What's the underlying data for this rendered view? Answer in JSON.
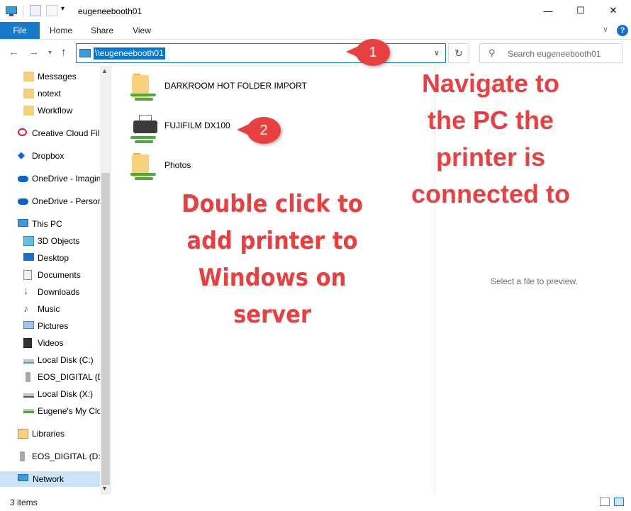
{
  "window": {
    "title": "eugeneebooth01"
  },
  "ribbon": {
    "tabs": [
      "File",
      "Home",
      "Share",
      "View"
    ]
  },
  "nav": {
    "address": "\\\\eugeneebooth01",
    "search_placeholder": "Search eugeneebooth01"
  },
  "sidebar": {
    "items": [
      {
        "label": "Messages",
        "icon": "folder-icon"
      },
      {
        "label": "notext",
        "icon": "folder-icon"
      },
      {
        "label": "Workflow",
        "icon": "folder-icon"
      },
      {
        "label": "Creative Cloud Fil",
        "icon": "creative-cloud-icon"
      },
      {
        "label": "Dropbox",
        "icon": "dropbox-icon"
      },
      {
        "label": "OneDrive - Imagin",
        "icon": "onedrive-icon"
      },
      {
        "label": "OneDrive - Person",
        "icon": "onedrive-icon"
      },
      {
        "label": "This PC",
        "icon": "pc-icon"
      },
      {
        "label": "3D Objects",
        "icon": "3d-objects-icon"
      },
      {
        "label": "Desktop",
        "icon": "desktop-icon"
      },
      {
        "label": "Documents",
        "icon": "documents-icon"
      },
      {
        "label": "Downloads",
        "icon": "downloads-icon"
      },
      {
        "label": "Music",
        "icon": "music-icon"
      },
      {
        "label": "Pictures",
        "icon": "pictures-icon"
      },
      {
        "label": "Videos",
        "icon": "videos-icon"
      },
      {
        "label": "Local Disk (C:)",
        "icon": "disk-icon"
      },
      {
        "label": "EOS_DIGITAL (D:",
        "icon": "usb-drive-icon"
      },
      {
        "label": "Local Disk (X:)",
        "icon": "disk-icon"
      },
      {
        "label": "Eugene's My Clo",
        "icon": "network-drive-icon"
      },
      {
        "label": "Libraries",
        "icon": "libraries-icon"
      },
      {
        "label": "EOS_DIGITAL (D:)",
        "icon": "usb-drive-icon"
      },
      {
        "label": "Network",
        "icon": "network-icon"
      }
    ]
  },
  "files": [
    {
      "name": "DARKROOM HOT FOLDER IMPORT",
      "icon": "shared-folder-icon"
    },
    {
      "name": "FUJIFILM DX100",
      "icon": "printer-icon"
    },
    {
      "name": "Photos",
      "icon": "shared-folder-icon"
    }
  ],
  "preview": {
    "text": "Select a file to preview."
  },
  "callouts": [
    "1",
    "2"
  ],
  "annotations": {
    "navigate": "Navigate to the PC the printer is connected to",
    "double_click": "Double click to add printer to Windows on server"
  },
  "status": {
    "items": "3 items"
  },
  "colors": {
    "accent": "#1979ca",
    "annotation": "#e84040",
    "selection": "#cce4f7"
  }
}
